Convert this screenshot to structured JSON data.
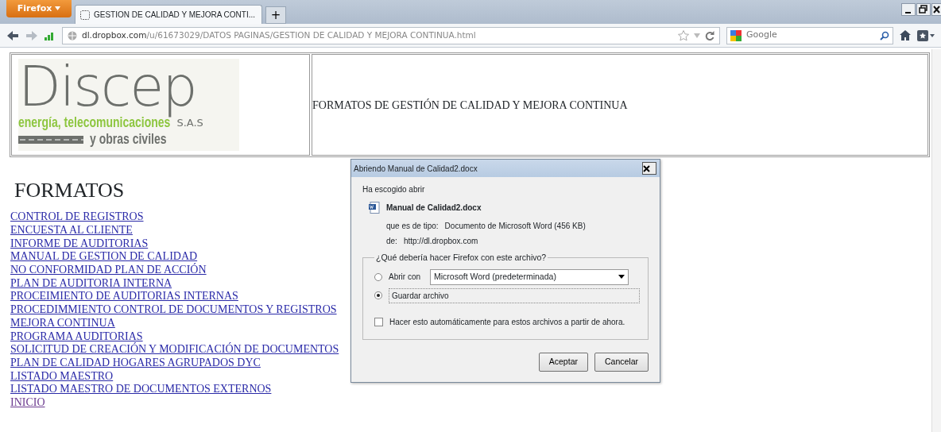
{
  "browser": {
    "menu_button": "Firefox",
    "tabs": [
      {
        "label": "GESTION DE CALIDAD Y MEJORA CONTI...",
        "selected": true
      }
    ],
    "new_tab": "+",
    "url_host": "dl.dropbox.com",
    "url_path": "/u/61673029/DATOS PAGINAS/GESTION DE CALIDAD Y MEJORA CONTINUA.html",
    "search_placeholder": "Google"
  },
  "header": {
    "logo": {
      "wordmark": "Discep",
      "tagline_1": "energía, telecomunicaciones",
      "tagline_2": "y obras civiles",
      "suffix": "S.A.S"
    },
    "title": "FORMATOS DE GESTIÓN  DE CALIDAD Y MEJORA CONTINUA"
  },
  "heading": "FORMATOS",
  "links": [
    {
      "label": "CONTROL DE REGISTROS",
      "visited": false
    },
    {
      "label": "ENCUESTA AL CLIENTE",
      "visited": false
    },
    {
      "label": "INFORME DE AUDITORIAS",
      "visited": false
    },
    {
      "label": "MANUAL DE GESTION DE CALIDAD",
      "visited": false
    },
    {
      "label": "NO CONFORMIDAD PLAN DE ACCIÓN",
      "visited": false
    },
    {
      "label": "PLAN DE AUDITORIA INTERNA",
      "visited": false
    },
    {
      "label": "PROCEIMIENTO DE AUDITORIAS INTERNAS",
      "visited": false
    },
    {
      "label": "PROCEDIMMIENTO CONTROL DE DOCUMENTOS Y REGISTROS",
      "visited": false
    },
    {
      "label": "MEJORA CONTINUA",
      "visited": false
    },
    {
      "label": "PROGRAMA AUDITORIAS",
      "visited": false
    },
    {
      "label": "SOLICITUD DE CREACIÓN Y MODIFICACIÓN DE DOCUMENTOS",
      "visited": false
    },
    {
      "label": "PLAN DE CALIDAD HOGARES AGRUPADOS DYC",
      "visited": false
    },
    {
      "label": "LISTADO MAESTRO",
      "visited": false
    },
    {
      "label": "LISTADO MAESTRO DE DOCUMENTOS EXTERNOS",
      "visited": false
    },
    {
      "label": "INICIO",
      "visited": true
    }
  ],
  "dialog": {
    "title": "Abriendo Manual de Calidad2.docx",
    "intro": "Ha escogido abrir",
    "file_name": "Manual de Calidad2.docx",
    "type_label": "que es de tipo:",
    "type_value": "Documento de Microsoft Word (456 KB)",
    "from_label": "de:",
    "from_value": "http://dl.dropbox.com",
    "group_label": "¿Qué debería hacer Firefox con este archivo?",
    "options": [
      {
        "kind": "open",
        "label": "Abrir con",
        "selected": false,
        "app": "Microsoft Word (predeterminada)"
      },
      {
        "kind": "save",
        "label": "Guardar archivo",
        "selected": true
      }
    ],
    "auto": {
      "label": "Hacer esto automáticamente para estos archivos a partir de ahora.",
      "checked": false
    },
    "buttons": [
      "Aceptar",
      "Cancelar"
    ]
  }
}
